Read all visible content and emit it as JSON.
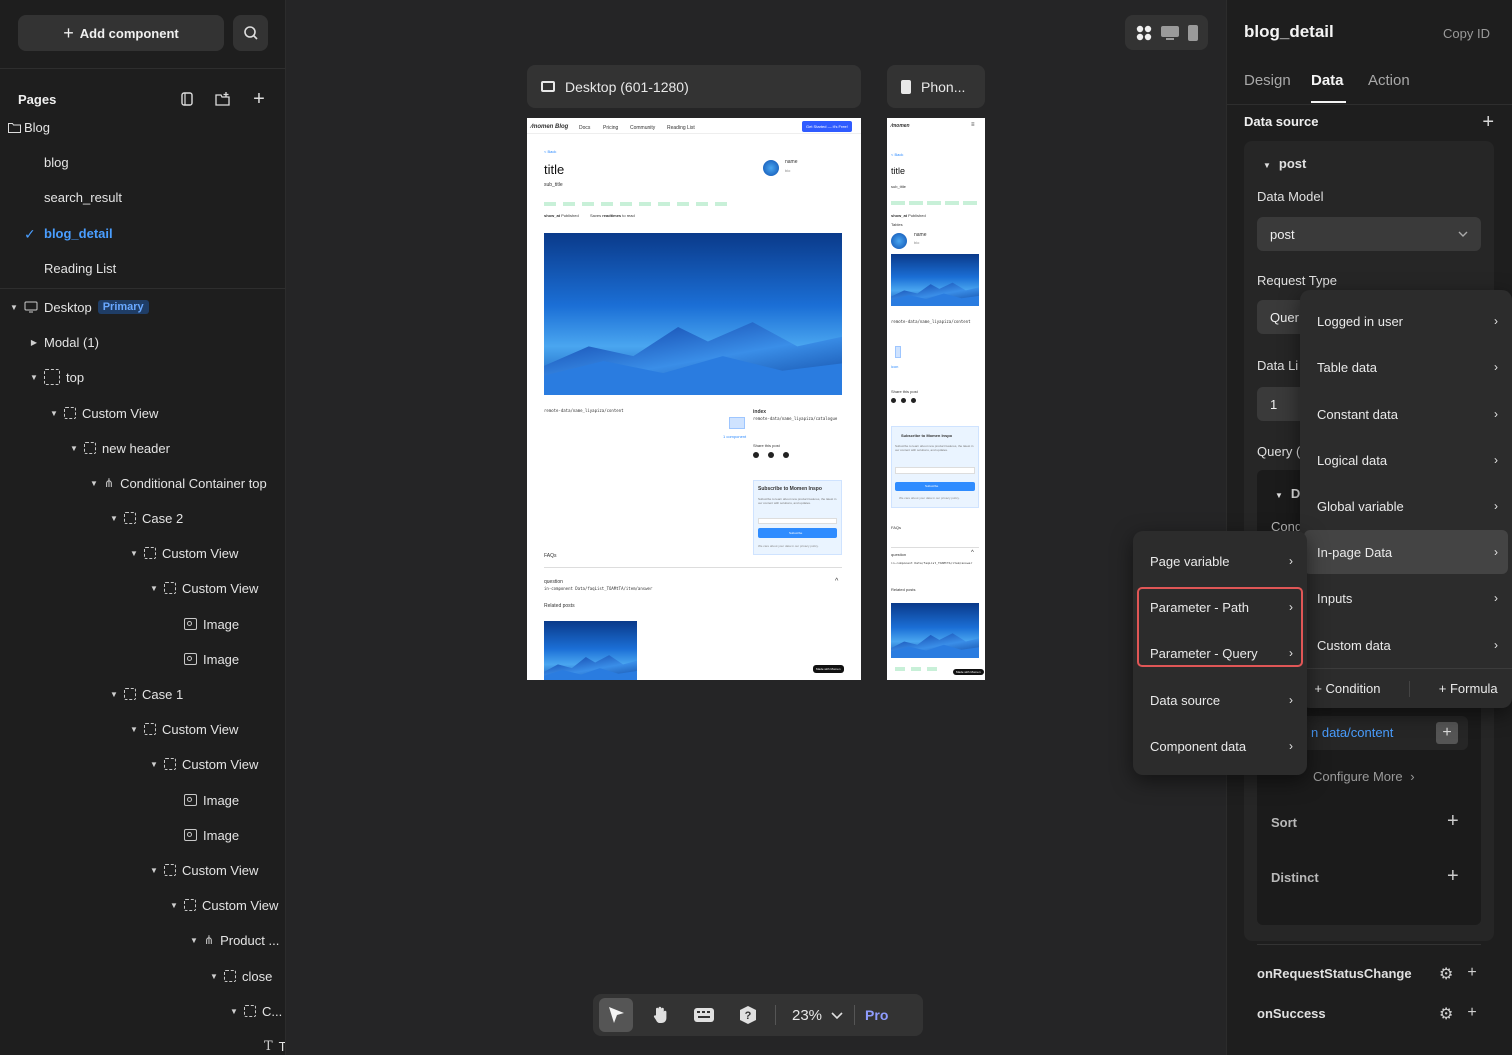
{
  "left": {
    "add_component": "Add component",
    "pages_title": "Pages",
    "pages": [
      "Blog",
      "blog",
      "search_result",
      "blog_detail",
      "Reading List"
    ],
    "active_page": "blog_detail",
    "tree": {
      "desktop": "Desktop",
      "desktop_badge": "Primary",
      "modal": "Modal (1)",
      "top": "top",
      "custom_view": "Custom View",
      "new_header": "new header",
      "conditional": "Conditional Container top",
      "case2": "Case 2",
      "case1": "Case 1",
      "image": "Image",
      "custom_view_trunc": "Custom View",
      "product": "Product ...",
      "close": "close",
      "c_trunc": "C...",
      "t_trunc": "T"
    }
  },
  "canvas": {
    "desktop_label": "Desktop (601-1280)",
    "phone_label": "Phon...",
    "preview": {
      "nav": [
        "Docs",
        "Pricing",
        "Community",
        "Reading List"
      ],
      "cta": "Get Started — it's Free!",
      "back": "< Back",
      "title": "title",
      "sub_title": "sub_title",
      "name": "name",
      "bio": "bio",
      "show_at": "show_at",
      "published": "Published",
      "saves": "Saves",
      "readtime": "readtimes",
      "to_read": "to read",
      "content_path": "remote-data/name_liyapiza/content",
      "index": "index",
      "catalogue_path": "remote-data/name_liyapiza/catalogue",
      "component": "1 component",
      "share": "Share this post",
      "subscribe_title": "Subscribe to Momen Inspo",
      "subscribe_desc": "Subscribe to learn about new product features, the latest in our content with solutions, and updates.",
      "subscribe_btn": "Subscribe",
      "privacy": "We care about your data in our privacy policy.",
      "faqs": "FAQs",
      "question": "question",
      "answer_path": "in-component Data/faqList_TOAMtTA/item/answer",
      "related": "Related posts",
      "made": "Made with Momen",
      "phone_tables": "Tables",
      "phone_icon": "icon"
    }
  },
  "toolbar": {
    "zoom": "23%",
    "pro": "Pro"
  },
  "right": {
    "title": "blog_detail",
    "copy_id": "Copy ID",
    "tabs": [
      "Design",
      "Data",
      "Action"
    ],
    "data_source": "Data source",
    "post": "post",
    "data_model_label": "Data Model",
    "data_model_value": "post",
    "request_type_label": "Request Type",
    "request_type_value": "Quer",
    "data_limit_label": "Data Li",
    "data_limit_value": "1",
    "query_label": "Query (",
    "d_label": "D",
    "cond_label": "Cond",
    "content_link": "n data/content",
    "configure_more": "Configure More",
    "sort": "Sort",
    "distinct": "Distinct",
    "events": [
      "onRequestStatusChange",
      "onSuccess"
    ]
  },
  "menu_main": {
    "items": [
      "Logged in user",
      "Table data",
      "Constant data",
      "Logical data",
      "Global variable",
      "In-page Data",
      "Inputs",
      "Custom data"
    ],
    "highlighted": "In-page Data",
    "footer_condition": "+ Condition",
    "footer_formula": "+ Formula"
  },
  "menu_sub": {
    "items": [
      "Page variable",
      "Parameter - Path",
      "Parameter - Query",
      "Data source",
      "Component data"
    ]
  },
  "colors": {
    "accent": "#4a9eff",
    "highlight_box": "#e05656",
    "pro": "#8f9cff"
  }
}
